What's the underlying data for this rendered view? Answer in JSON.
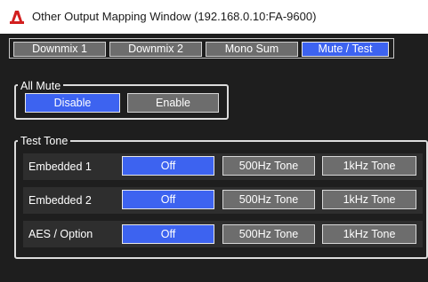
{
  "window": {
    "title": "Other Output Mapping Window (192.168.0.10:FA-9600)",
    "icon": "red-app-logo-icon"
  },
  "tabs": [
    {
      "label": "Downmix 1",
      "active": false
    },
    {
      "label": "Downmix 2",
      "active": false
    },
    {
      "label": "Mono Sum",
      "active": false
    },
    {
      "label": "Mute / Test",
      "active": true
    }
  ],
  "all_mute": {
    "label": "All Mute",
    "disable_label": "Disable",
    "enable_label": "Enable",
    "selected": "Disable"
  },
  "test_tone": {
    "label": "Test Tone",
    "rows": [
      {
        "name": "Embedded 1",
        "off": "Off",
        "t500": "500Hz Tone",
        "t1k": "1kHz Tone",
        "selected": "Off"
      },
      {
        "name": "Embedded 2",
        "off": "Off",
        "t500": "500Hz Tone",
        "t1k": "1kHz Tone",
        "selected": "Off"
      },
      {
        "name": "AES / Option",
        "off": "Off",
        "t500": "500Hz Tone",
        "t1k": "1kHz Tone",
        "selected": "Off"
      }
    ]
  },
  "colors": {
    "background": "#1e1e1e",
    "active_blue": "#3d63f0",
    "inactive_gray": "#6d6d6d",
    "row_background": "#2e2e2e",
    "logo_red": "#d21f1f"
  }
}
